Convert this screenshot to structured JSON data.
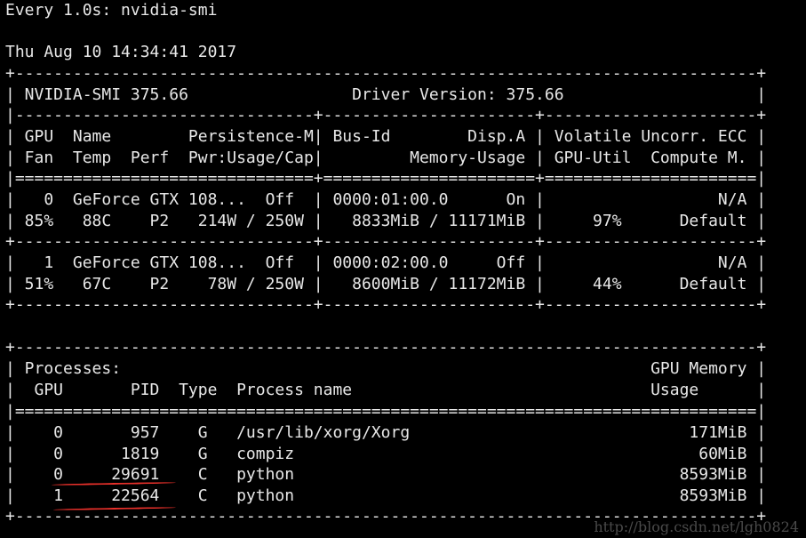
{
  "terminal": {
    "lines": [
      "Every 1.0s: nvidia-smi",
      "",
      "Thu Aug 10 14:34:41 2017",
      "+-----------------------------------------------------------------------------+",
      "| NVIDIA-SMI 375.66                 Driver Version: 375.66                    |",
      "|-------------------------------+----------------------+----------------------+",
      "| GPU  Name        Persistence-M| Bus-Id        Disp.A | Volatile Uncorr. ECC |",
      "| Fan  Temp  Perf  Pwr:Usage/Cap|         Memory-Usage | GPU-Util  Compute M. |",
      "|===============================+======================+======================|",
      "|   0  GeForce GTX 108...  Off  | 0000:01:00.0      On |                  N/A |",
      "| 85%   88C    P2   214W / 250W |   8833MiB / 11171MiB |     97%      Default |",
      "+-------------------------------+----------------------+----------------------+",
      "|   1  GeForce GTX 108...  Off  | 0000:02:00.0     Off |                  N/A |",
      "| 51%   67C    P2    78W / 250W |   8600MiB / 11172MiB |     44%      Default |",
      "+-------------------------------+----------------------+----------------------+",
      "",
      "+-----------------------------------------------------------------------------+",
      "| Processes:                                                       GPU Memory |",
      "|  GPU       PID  Type  Process name                               Usage      |",
      "|=============================================================================|",
      "|    0       957    G   /usr/lib/xorg/Xorg                             171MiB |",
      "|    0      1819    G   compiz                                          60MiB |",
      "|    0     29691    C   python                                        8593MiB |",
      "|    1     22564    C   python                                        8593MiB |",
      "+-----------------------------------------------------------------------------+"
    ]
  },
  "watermark": {
    "text": "http://blog.csdn.net/lgh0824"
  },
  "annotations": {
    "underline_color": "#e8302a"
  }
}
